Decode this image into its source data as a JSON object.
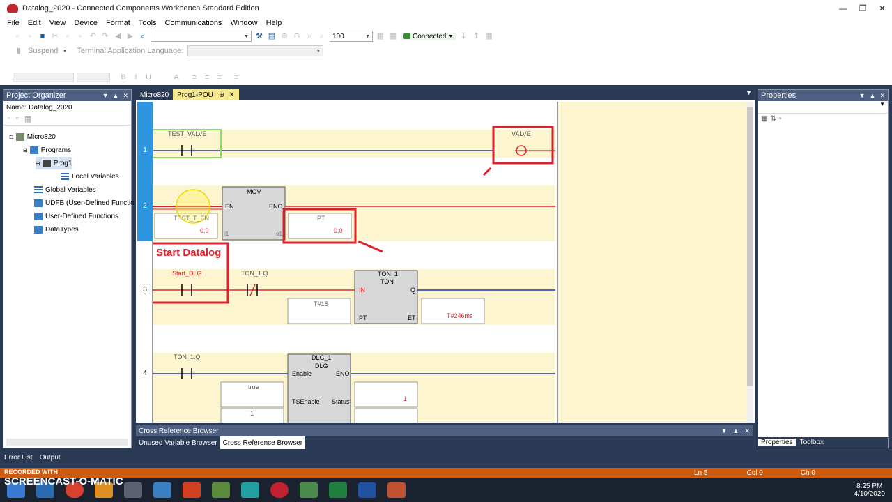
{
  "window": {
    "title": "Datalog_2020 - Connected Components Workbench Standard Edition"
  },
  "menu": [
    "File",
    "Edit",
    "View",
    "Device",
    "Format",
    "Tools",
    "Communications",
    "Window",
    "Help"
  ],
  "toolbar": {
    "zoom": "100",
    "status": "Connected",
    "suspend": "Suspend",
    "term_lang": "Terminal Application Language:"
  },
  "organizer": {
    "title": "Project Organizer",
    "name_label": "Name:  Datalog_2020",
    "items": [
      {
        "label": "Micro820",
        "icon": "controller-icon"
      },
      {
        "label": "Programs",
        "icon": "folder-icon"
      },
      {
        "label": "Prog1",
        "icon": "program-icon"
      },
      {
        "label": "Local Variables",
        "icon": "list-icon"
      },
      {
        "label": "Global Variables",
        "icon": "list-icon"
      },
      {
        "label": "UDFB (User-Defined Functio",
        "icon": "udfb-icon"
      },
      {
        "label": "User-Defined Functions",
        "icon": "udf-icon"
      },
      {
        "label": "DataTypes",
        "icon": "datatype-icon"
      }
    ]
  },
  "editor": {
    "tabs": [
      "Micro820",
      "Prog1-POU"
    ],
    "rungs": [
      {
        "num": "1",
        "contact": "TEST_VALVE",
        "coil": "VALVE"
      },
      {
        "num": "2",
        "block": "MOV",
        "en": "EN",
        "eno": "ENO",
        "input": "TEST_T_EN",
        "input_val": "0.0",
        "out_var": "PT",
        "out_val": "0.0",
        "i1": "i1",
        "o1": "o1"
      },
      {
        "num": "3",
        "contact1": "Start_DLG",
        "contact2": "TON_1.Q",
        "block_name": "TON_1",
        "block_type": "TON",
        "in": "IN",
        "q": "Q",
        "pt": "PT",
        "et": "ET",
        "pt_val": "T#1S",
        "et_val": "T#246ms"
      },
      {
        "num": "4",
        "contact": "TON_1.Q",
        "block_name": "DLG_1",
        "block_type": "DLG",
        "enable": "Enable",
        "eno": "ENO",
        "tsenable": "TSEnable",
        "status": "Status",
        "true_val": "true",
        "status_val": "1",
        "one": "1"
      }
    ],
    "annotation": "Start Datalog"
  },
  "xref": {
    "title": "Cross Reference Browser",
    "tabs": [
      "Unused Variable Browser",
      "Cross Reference Browser"
    ]
  },
  "properties": {
    "title": "Properties",
    "tabs": [
      "Properties",
      "Toolbox"
    ]
  },
  "bottom": {
    "tabs": [
      "Error List",
      "Output"
    ]
  },
  "status": {
    "ln": "Ln 5",
    "col": "Col 0",
    "ch": "Ch 0"
  },
  "taskbar": {
    "time": "8:25 PM",
    "date": "4/10/2020"
  },
  "watermark": {
    "recorded": "RECORDED WITH",
    "brand": "SCREENCAST-O-MATIC"
  },
  "colors": {
    "accent": "#e0202a",
    "rung_bg": "#fdf5d0",
    "wire_blue": "#2030c8",
    "wire_red": "#e0202a",
    "connected_green": "#3a8a3a"
  }
}
